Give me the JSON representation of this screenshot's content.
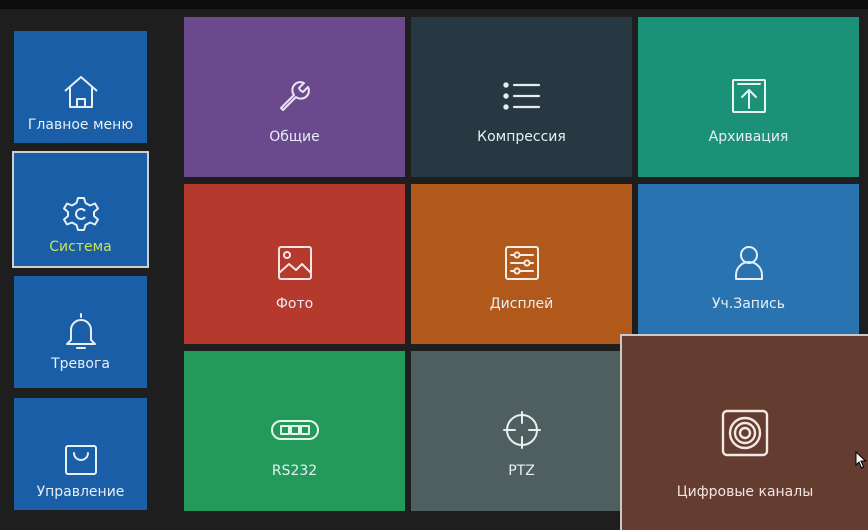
{
  "sidebar": {
    "items": [
      {
        "label": "Главное меню",
        "icon": "home-icon",
        "selected": false
      },
      {
        "label": "Система",
        "icon": "gear-icon",
        "selected": true
      },
      {
        "label": "Тревога",
        "icon": "bell-icon",
        "selected": false
      },
      {
        "label": "Управление",
        "icon": "bag-icon",
        "selected": false
      }
    ]
  },
  "tiles": [
    {
      "label": "Общие",
      "icon": "wrench-icon",
      "color": "#6a4a8c"
    },
    {
      "label": "Компрессия",
      "icon": "list-icon",
      "color": "#283843"
    },
    {
      "label": "Архивация",
      "icon": "upload-icon",
      "color": "#1b9178"
    },
    {
      "label": "Фото",
      "icon": "image-icon",
      "color": "#b5392c"
    },
    {
      "label": "Дисплей",
      "icon": "sliders-icon",
      "color": "#b0591a"
    },
    {
      "label": "Уч.Запись",
      "icon": "user-icon",
      "color": "#2974b0"
    },
    {
      "label": "RS232",
      "icon": "port-icon",
      "color": "#239a5a"
    },
    {
      "label": "PTZ",
      "icon": "crosshair-icon",
      "color": "#4f5f5f"
    }
  ],
  "popup": {
    "label": "Цифровые каналы",
    "icon": "speaker-icon",
    "color": "#653c30"
  },
  "colors": {
    "nav_bg": "#1a5ea8",
    "selected_text": "#c6e35a",
    "selected_border": "#cfcfcf"
  }
}
